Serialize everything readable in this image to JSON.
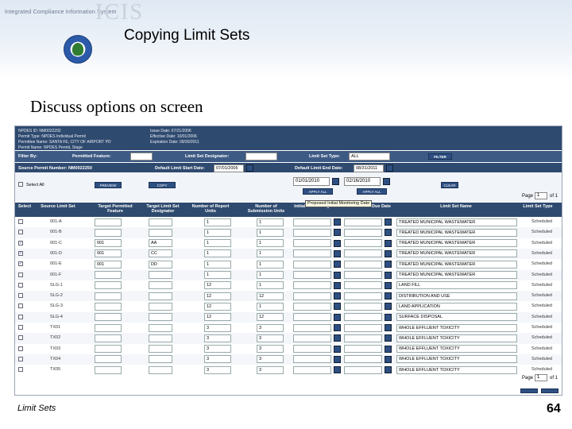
{
  "header": {
    "logo_text": "Integrated Compliance Information System",
    "logo_word": "ICIS",
    "title": "Copying Limit Sets"
  },
  "subtitle": "Discuss options on screen",
  "screen": {
    "info_left": [
      "NPDES ID: NM0022292",
      "Permit Type: NPDES Individual Permit",
      "Permittee Name: SANTA FE, CITY OF AIRPORT PD",
      "Permit Name: NPDES Permit, Stage"
    ],
    "info_right": [
      "Issue Date: 07/21/2006",
      "Effective Date: 10/01/2006",
      "Expiration Date: 09/30/2011"
    ],
    "filter": {
      "filter_label": "Filter By:",
      "permitted_feature_label": "Permitted Feature:",
      "limit_set_designator_label": "Limit Set Designator:",
      "limit_set_type_label": "Limit Set Type:",
      "limit_set_type_value": "ALL",
      "filter_button": "FILTER"
    },
    "source": {
      "source_permit_label": "Source Permit Number: NM0022250",
      "start_date_label": "Default Limit Start Date:",
      "start_date_value": "07/01/2006",
      "end_date_label": "Default Limit End Date:",
      "end_date_value": "08/31/2011"
    },
    "controls": {
      "select_all": "Select All",
      "btn_preview": "PREVIEW",
      "btn_copy": "COPY",
      "date1": "01/01/2010",
      "date2": "02/16/2010",
      "btn_apply1": "APPLY ALL",
      "btn_apply2": "APPLY ALL",
      "btn_clear": "CLEAR",
      "page_label": "Page",
      "page_value": "1",
      "page_of": "of 1"
    },
    "columns": [
      "Select",
      "Source Limit Set",
      "Target Permitted Feature",
      "Target Limit Set Designator",
      "Number of Report Units",
      "Number of Submission Units",
      "Initial Monitoring Date",
      "Initial DMR Due Date",
      "Limit Set Name",
      "Limit Set Type"
    ],
    "tooltip": "Proposed Initial Monitoring Date",
    "rows": [
      {
        "checked": "",
        "source": "001-A",
        "feature": "",
        "designator": "",
        "report": "1",
        "submission": "1",
        "name": "TREATED MUNICIPAL WASTEWATER",
        "type": "Scheduled"
      },
      {
        "checked": "",
        "source": "001-B",
        "feature": "",
        "designator": "",
        "report": "1",
        "submission": "1",
        "name": "TREATED MUNICIPAL WASTEWATER",
        "type": "Scheduled"
      },
      {
        "checked": "✓",
        "source": "001-C",
        "feature": "001",
        "designator": "AA",
        "report": "1",
        "submission": "1",
        "name": "TREATED MUNICIPAL WASTEWATER",
        "type": "Scheduled"
      },
      {
        "checked": "✓",
        "source": "001-D",
        "feature": "001",
        "designator": "CC",
        "report": "1",
        "submission": "1",
        "name": "TREATED MUNICIPAL WASTEWATER",
        "type": "Scheduled"
      },
      {
        "checked": "✓",
        "source": "001-E",
        "feature": "001",
        "designator": "DD",
        "report": "1",
        "submission": "1",
        "name": "TREATED MUNICIPAL WASTEWATER",
        "type": "Scheduled"
      },
      {
        "checked": "",
        "source": "001-F",
        "feature": "",
        "designator": "",
        "report": "1",
        "submission": "1",
        "name": "TREATED MUNICIPAL WASTEWATER",
        "type": "Scheduled"
      },
      {
        "checked": "",
        "source": "SLG-1",
        "feature": "",
        "designator": "",
        "report": "12",
        "submission": "1",
        "name": "LAND FILL",
        "type": "Scheduled"
      },
      {
        "checked": "",
        "source": "SLG-2",
        "feature": "",
        "designator": "",
        "report": "12",
        "submission": "12",
        "name": "DISTRIBUTION AND USE",
        "type": "Scheduled"
      },
      {
        "checked": "",
        "source": "SLG-3",
        "feature": "",
        "designator": "",
        "report": "12",
        "submission": "1",
        "name": "LAND APPLICATION",
        "type": "Scheduled"
      },
      {
        "checked": "",
        "source": "SLG-4",
        "feature": "",
        "designator": "",
        "report": "12",
        "submission": "12",
        "name": "SURFACE DISPOSAL",
        "type": "Scheduled"
      },
      {
        "checked": "",
        "source": "TX01",
        "feature": "",
        "designator": "",
        "report": "3",
        "submission": "3",
        "name": "WHOLE EFFLUENT TOXICITY",
        "type": "Scheduled"
      },
      {
        "checked": "",
        "source": "TX02",
        "feature": "",
        "designator": "",
        "report": "3",
        "submission": "3",
        "name": "WHOLE EFFLUENT TOXICITY",
        "type": "Scheduled"
      },
      {
        "checked": "",
        "source": "TX03",
        "feature": "",
        "designator": "",
        "report": "3",
        "submission": "3",
        "name": "WHOLE EFFLUENT TOXICITY",
        "type": "Scheduled"
      },
      {
        "checked": "",
        "source": "TX04",
        "feature": "",
        "designator": "",
        "report": "3",
        "submission": "3",
        "name": "WHOLE EFFLUENT TOXICITY",
        "type": "Scheduled"
      },
      {
        "checked": "",
        "source": "TX05",
        "feature": "",
        "designator": "",
        "report": "3",
        "submission": "3",
        "name": "WHOLE EFFLUENT TOXICITY",
        "type": "Scheduled"
      }
    ],
    "bottom_page_label": "Page",
    "bottom_page_value": "1",
    "bottom_page_of": "of 1"
  },
  "footer": {
    "left": "Limit Sets",
    "page_number": "64"
  }
}
